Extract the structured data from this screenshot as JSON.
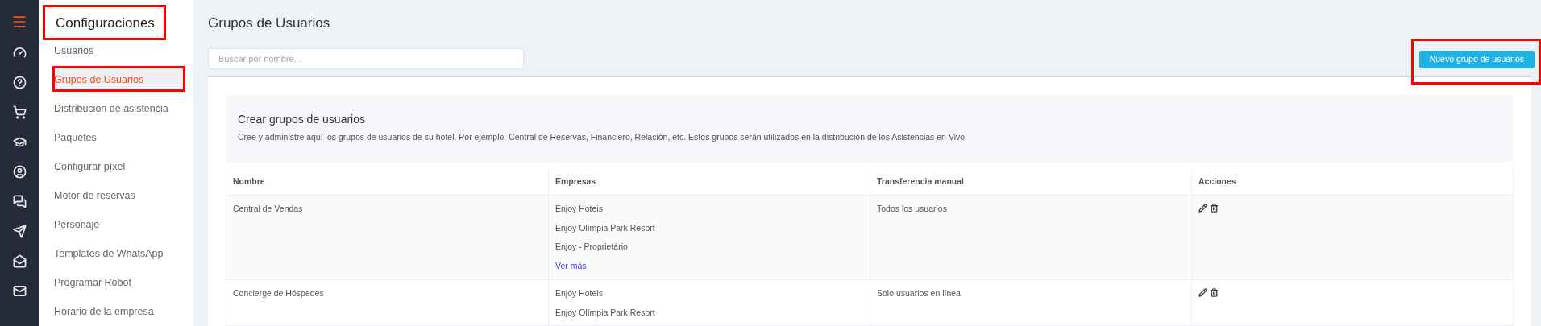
{
  "sidebar": {
    "title": {
      "text": "Configuraciones",
      "highlighted": true
    },
    "items": [
      {
        "label": "Usuarios",
        "selected": false,
        "highlighted": false
      },
      {
        "label": "Grupos de Usuarios",
        "selected": true,
        "highlighted": true
      },
      {
        "label": "Distribución de asistencia",
        "selected": false,
        "highlighted": false
      },
      {
        "label": "Paquetes",
        "selected": false,
        "highlighted": false
      },
      {
        "label": "Configurar píxel",
        "selected": false,
        "highlighted": false
      },
      {
        "label": "Motor de reservas",
        "selected": false,
        "highlighted": false
      },
      {
        "label": "Personaje",
        "selected": false,
        "highlighted": false
      },
      {
        "label": "Templates de WhatsApp",
        "selected": false,
        "highlighted": false
      },
      {
        "label": "Programar Robot",
        "selected": false,
        "highlighted": false
      },
      {
        "label": "Horario de la empresa",
        "selected": false,
        "highlighted": false
      }
    ]
  },
  "page_title": "Grupos de Usuarios",
  "search": {
    "placeholder": "Buscar por nombre..."
  },
  "new_button": {
    "label": "Nuevo grupo de usuarios",
    "highlighted": true
  },
  "info": {
    "title": "Crear grupos de usuarios",
    "description": "Cree y administre aquí los grupos de usuarios de su hotel. Por ejemplo: Central de Reservas, Financiero, Relación, etc. Estos grupos serán utilizados en la distribución de los Asistencias en Vivo."
  },
  "table": {
    "columns": [
      "Nombre",
      "Empresas",
      "Transferencia manual",
      "Acciones"
    ],
    "rows": [
      {
        "name": "Central de Vendas",
        "companies": [
          "Enjoy Hoteis",
          "Enjoy Olímpia Park Resort",
          "Enjoy - Proprietário"
        ],
        "more_link": "Ver más",
        "transfer": "Todos los usuarios"
      },
      {
        "name": "Concierge de Hóspedes",
        "companies": [
          "Enjoy Hoteis",
          "Enjoy Olímpia Park Resort"
        ],
        "transfer": "Solo usuarios en línea"
      }
    ]
  }
}
